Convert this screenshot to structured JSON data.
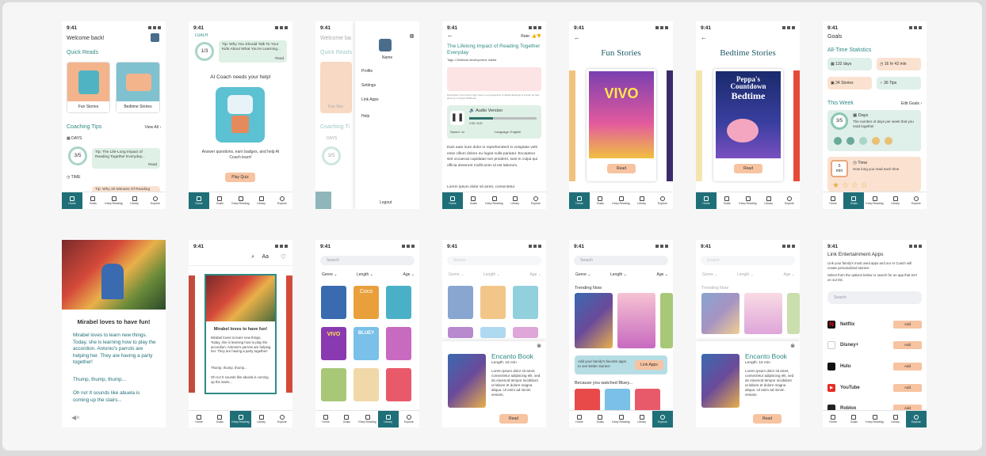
{
  "status_time": "9:41",
  "nav": {
    "home": "Home",
    "goals": "Goals",
    "keep": "Keep Reading",
    "library": "Library",
    "explore": "Explore"
  },
  "s1": {
    "welcome": "Welcome back!",
    "quick": "Quick Reads",
    "fun": "Fun Stories",
    "bed": "Bedtime Stories",
    "coaching": "Coaching Tips",
    "view_all": "View All",
    "days": "DAYS",
    "ratio": "3/5",
    "tip1": "Tip: The Life-Long Impact of Reading Together Everyday...",
    "read": "Read",
    "time": "TIME",
    "tip2": "Tip: Why 20 Minutes Of Reading"
  },
  "s2": {
    "logo": "LUALH",
    "ratio": "1/3",
    "tip": "Tip: Why You Should Talk To Your Kids About What You're Learning...",
    "read": "Read",
    "headline": "AI Coach needs your help!",
    "body": "Answer questions, earn badges, and help AI Coach learn!",
    "cta": "Play Quiz"
  },
  "s3": {
    "name": "Name",
    "menu": [
      "Profile",
      "Settings",
      "Link Apps",
      "Help"
    ],
    "logout": "Logout",
    "bg_welcome": "Welcome ba",
    "bg_quick": "Quick Reads",
    "bg_fun": "Fun Stor",
    "bg_coach": "Coaching Ti",
    "bg_days": "DAYS",
    "bg_ratio": "3/5"
  },
  "s4": {
    "rate": "Rate:",
    "title": "The Lifelong Impact of Reading Together Everyday",
    "tags": "Tags: Childhood development, habits",
    "caption": "Description: from left to right, there is a progression of digital drawings of a baby as they grow up, through childhood.",
    "audio": "Audio Version",
    "time": "2:06 / 6:00",
    "speed": "Speed:",
    "speed_val": "1x",
    "language": "Language:",
    "lang_val": "English",
    "body": "Duis aute irure dolor in reprehenderit in voluptate velit esse cillum dolore eu fugiat nulla pariatur. Excepteur sint occaecat cupidatat non proident, sunt in culpa qui officia deserunt mollit anim id est laborum.",
    "body2": "Lorem ipsum dolor sit amet, consectetur"
  },
  "s5": {
    "title": "Fun Stories",
    "book": "VIVO",
    "read": "Read"
  },
  "s6": {
    "title": "Bedtime Stories",
    "book1": "Peppa's",
    "book2": "Countdown",
    "book3": "Bedtime",
    "read": "Read"
  },
  "s7": {
    "goals": "Goals",
    "all_time": "All-Time Statistics",
    "days": "132 days",
    "time": "16 hr 42 min",
    "stories": "34 Stories",
    "tips": "36 Tips",
    "this_week": "This Week",
    "edit": "Edit Goals",
    "ratio": "3/5",
    "days_h": "Days",
    "days_d": "The number of days per week that you read together",
    "min_n": "5",
    "min_u": "min",
    "time_h": "Time",
    "time_d": "How long you read each time"
  },
  "s8": {
    "title": "Mirabel loves to have fun!",
    "p1": "Mirabel loves to learn new things. Today, she is learning how to play the accordion. Antonio's parrots are helping her. They are having a party together!",
    "p2": "Thump, thump, thump...",
    "p3": "Oh no! It sounds like abuela is coming up the stairs..."
  },
  "s9": {
    "aa": "Aa",
    "title": "Mirabel loves to have fun!",
    "p1": "Mirabel loves to learn new things. Today, she is learning how to play the accordion. Antonio's parrots are helping her. They are having a party together!",
    "p2": "Thump, thump, thump...",
    "p3": "Oh no! It sounds like abuela is coming up the stairs..."
  },
  "s10": {
    "search": "Search",
    "genre": "Genre",
    "length": "Length",
    "age": "Age",
    "books": [
      "VIVO",
      "BLUEY",
      "Coco"
    ]
  },
  "s11": {
    "search": "Search",
    "genre": "Genre",
    "length": "Length",
    "age": "Age",
    "title": "Encanto Book",
    "length_v": "Length: 15 min",
    "desc": "Lorem ipsum dolor sit amet, consectetur adipiscing elit, sed do eiusmod tempor incididunt ut labore et dolore magna aliqua. Ut enim ad minim veniam,",
    "read": "Read"
  },
  "s12": {
    "search": "Search",
    "genre": "Genre",
    "length": "Length",
    "age": "Age",
    "trending": "Trending Now",
    "banner": "Add your family's favorite apps to see better stories!",
    "link": "Link Apps",
    "because": "Because you watched Bluey..."
  },
  "s13": {
    "search": "Search",
    "genre": "Genre",
    "length": "Length",
    "age": "Age",
    "trending": "Trending Now",
    "title": "Encanto Book",
    "length_v": "Length: 15 min",
    "desc": "Lorem ipsum dolor sit amet, consectetur adipiscing elit, sed do eiusmod tempor incididunt ut labore et dolore magna aliqua. Ut enim ad minim veniam.",
    "read": "Read"
  },
  "s14": {
    "title": "Link Entertainment Apps",
    "p1": "Link your family's most used apps and our AI Coach will create personalized stories!",
    "p2": "Select from the options below or search for an app that isn't on our list.",
    "search": "Search",
    "apps": [
      "Netflix",
      "Disney+",
      "Hulu",
      "YouTube",
      "Roblox"
    ],
    "add": "Add"
  }
}
